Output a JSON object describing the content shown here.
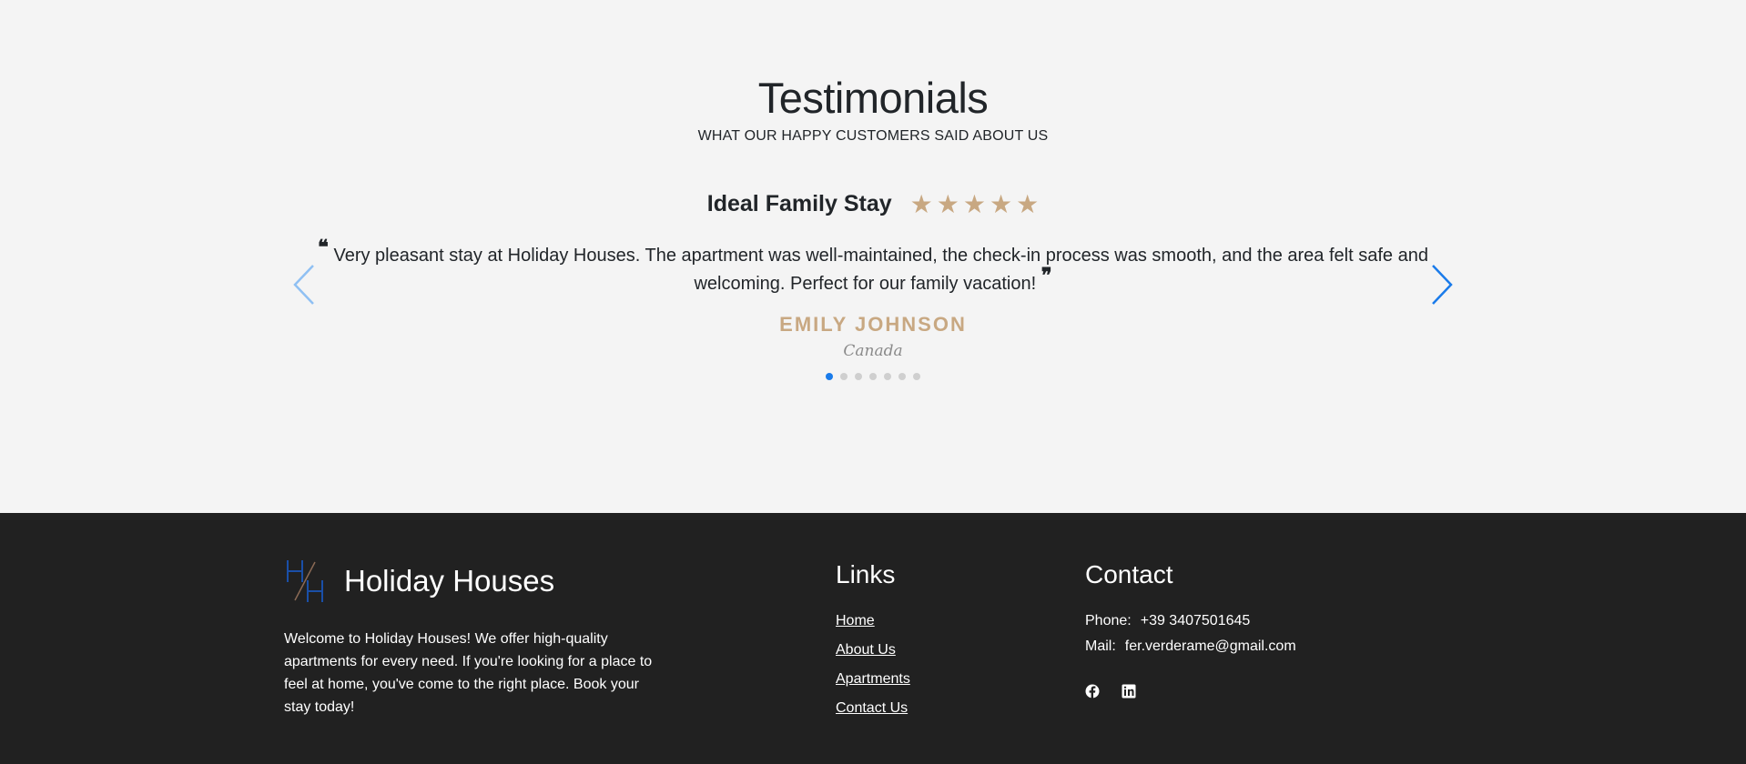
{
  "testimonials": {
    "heading": "Testimonials",
    "subheading": "WHAT OUR HAPPY CUSTOMERS SAID ABOUT US",
    "review": {
      "title": "Ideal Family Stay",
      "rating": 5,
      "rating_max": 5,
      "star_glyph": "★",
      "quote_open": "❝",
      "quote_close": "❞",
      "text": "Very pleasant stay at Holiday Houses. The apartment was well-maintained, the check-in process was smooth, and the area felt safe and welcoming. Perfect for our family vacation!",
      "author": "EMILY JOHNSON",
      "country": "Canada"
    },
    "slides_total": 7,
    "active_slide": 1
  },
  "footer": {
    "brand_name": "Holiday Houses",
    "about": "Welcome to Holiday Houses! We offer high-quality apartments for every need. If you're looking for a place to feel at home, you've come to the right place. Book your stay today!",
    "links_title": "Links",
    "links": [
      "Home",
      "About Us",
      "Apartments",
      "Contact Us"
    ],
    "contact_title": "Contact",
    "phone_label": "Phone:",
    "phone": "+39 3407501645",
    "mail_label": "Mail:",
    "mail": "fer.verderame@gmail.com",
    "social_icons": [
      "facebook-icon",
      "linkedin-icon"
    ]
  },
  "colors": {
    "page_bg": "#f4f4f4",
    "footer_bg": "#212121",
    "accent_gold": "#c8a882",
    "accent_blue": "#1a7bea",
    "text_dark": "#212529"
  }
}
